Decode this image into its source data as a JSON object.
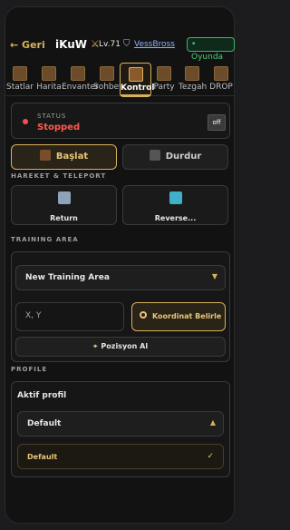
{
  "header": {
    "back_label": "← Geri",
    "player_name": "iKuW",
    "level": "Lv.71",
    "guild_name": "VessBross",
    "status_badge": "• Oyunda"
  },
  "tabs": [
    {
      "label": "Statlar"
    },
    {
      "label": "Harita"
    },
    {
      "label": "Envanter"
    },
    {
      "label": "Sohbet"
    },
    {
      "label": "Kontrol"
    },
    {
      "label": "Party"
    },
    {
      "label": "Tezgah"
    },
    {
      "label": "DROP"
    }
  ],
  "status": {
    "label": "STATUS",
    "value": "Stopped",
    "icon_text": "off"
  },
  "controls": {
    "start_label": "Başlat",
    "stop_label": "Durdur"
  },
  "hareket": {
    "title": "HAREKET & TELEPORT",
    "return_label": "Return",
    "reverse_label": "Reverse..."
  },
  "training": {
    "title": "TRAINING AREA",
    "selected_area": "New Training Area",
    "xy_placeholder": "X, Y",
    "coord_button": "Koordinat Belirle",
    "position_button": "Pozisyon Al"
  },
  "profile": {
    "section_title": "PROFILE",
    "card_title": "Aktif profil",
    "selected": "Default",
    "option": "Default"
  },
  "colors": {
    "accent": "#d8b15c",
    "status_stopped": "#ff5a4e",
    "online": "#46d17b"
  }
}
